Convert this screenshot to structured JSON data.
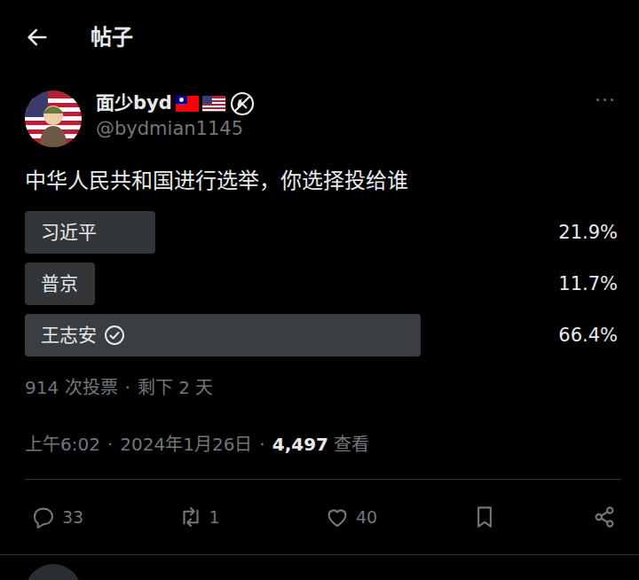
{
  "header": {
    "title": "帖子"
  },
  "post": {
    "name": "面少byd",
    "handle": "@bydmian1145",
    "more": "···",
    "text": "中华人民共和国进行选举，你选择投给谁",
    "poll": {
      "options": [
        {
          "label": "习近平",
          "percent": "21.9%",
          "level": 0.219,
          "selected": false
        },
        {
          "label": "普京",
          "percent": "11.7%",
          "level": 0.117,
          "selected": false
        },
        {
          "label": "王志安",
          "percent": "66.4%",
          "level": 0.664,
          "selected": true
        }
      ],
      "votes": "914 次投票",
      "separator": "·",
      "remaining": "剩下 2 天"
    },
    "meta": {
      "time": "上午6:02",
      "separator": "·",
      "date": "2024年1月26日",
      "views": "4,497",
      "views_label": "查看"
    },
    "actions": [
      {
        "kind": "reply",
        "count": "33"
      },
      {
        "kind": "retweet",
        "count": "1"
      },
      {
        "kind": "like",
        "count": "40"
      },
      {
        "kind": "bookmark",
        "count": ""
      },
      {
        "kind": "share",
        "count": ""
      }
    ]
  }
}
